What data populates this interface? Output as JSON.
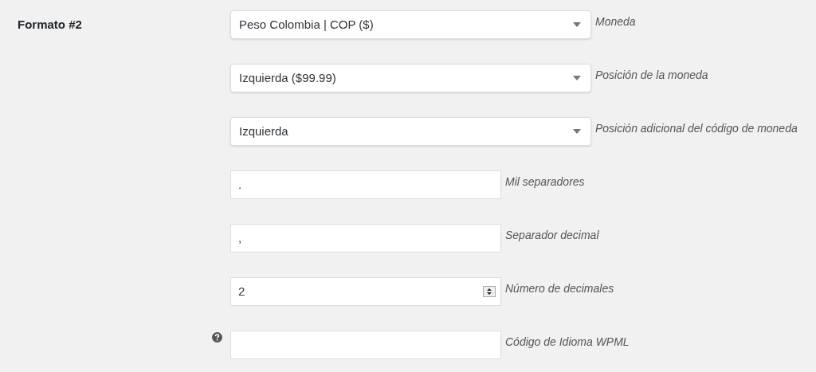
{
  "section_title": "Formato #2",
  "fields": [
    {
      "kind": "select",
      "value": "Peso Colombia | COP ($)",
      "description": "Moneda",
      "help": false
    },
    {
      "kind": "select",
      "value": "Izquierda ($99.99)",
      "description": "Posición de la moneda",
      "help": false
    },
    {
      "kind": "select",
      "value": "Izquierda",
      "description": "Posición adicional del código de moneda",
      "help": false
    },
    {
      "kind": "text",
      "value": ".",
      "description": "Mil separadores",
      "help": false
    },
    {
      "kind": "text",
      "value": ",",
      "description": "Separador decimal",
      "help": false
    },
    {
      "kind": "number",
      "value": "2",
      "description": "Número de decimales",
      "help": false
    },
    {
      "kind": "text",
      "description": "Código de Idioma WPML",
      "help": true
    }
  ]
}
